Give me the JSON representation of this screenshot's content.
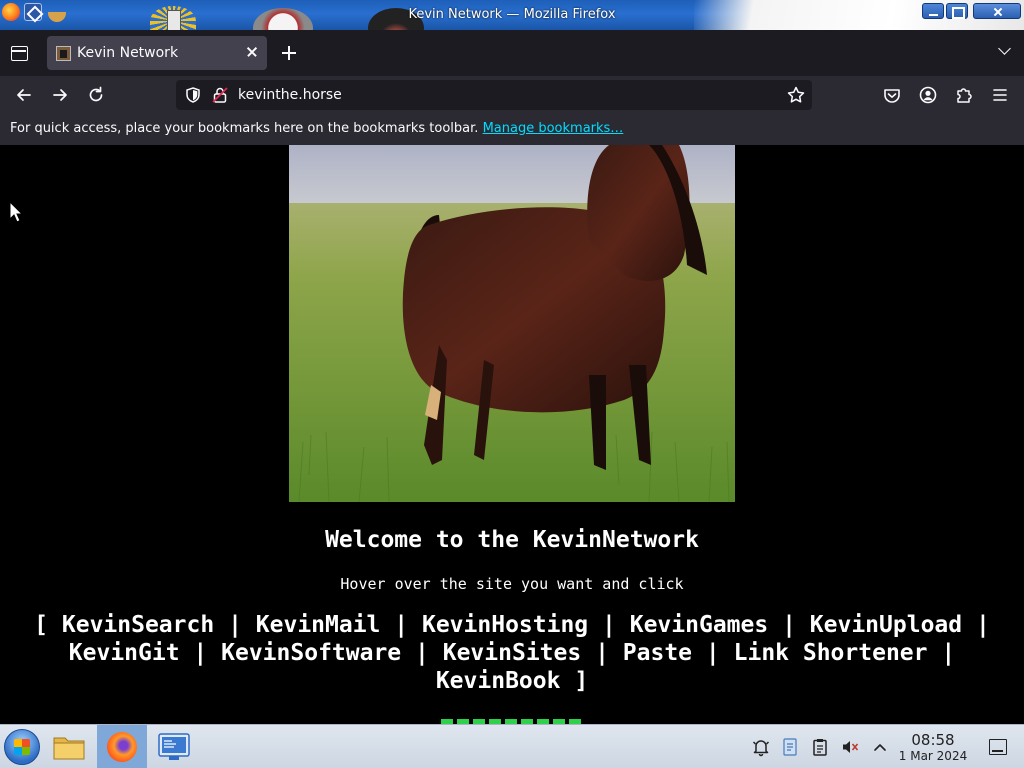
{
  "window": {
    "title": "Kevin Network — Mozilla Firefox"
  },
  "tabs": [
    {
      "label": "Kevin Network",
      "active": true
    }
  ],
  "toolbar": {
    "url": "kevinthe.horse"
  },
  "bookmarks_bar": {
    "message": "For quick access, place your bookmarks here on the bookmarks toolbar.",
    "link_label": "Manage bookmarks…"
  },
  "page": {
    "heading": "Welcome to the KevinNetwork",
    "subheading": "Hover over the site you want and click",
    "links": [
      "KevinSearch",
      "KevinMail",
      "KevinHosting",
      "KevinGames",
      "KevinUpload",
      "KevinGit",
      "KevinSoftware",
      "KevinSites",
      "Paste",
      "Link Shortener",
      "KevinBook"
    ],
    "bracket_open": "[",
    "bracket_close": "]",
    "separator": "|"
  },
  "taskbar": {
    "time": "08:58",
    "date": "1 Mar 2024"
  },
  "colors": {
    "link_accent": "#00ddff",
    "browser_chrome": "#2b2a33",
    "tab_strip": "#1c1b22",
    "page_background": "#000000"
  }
}
